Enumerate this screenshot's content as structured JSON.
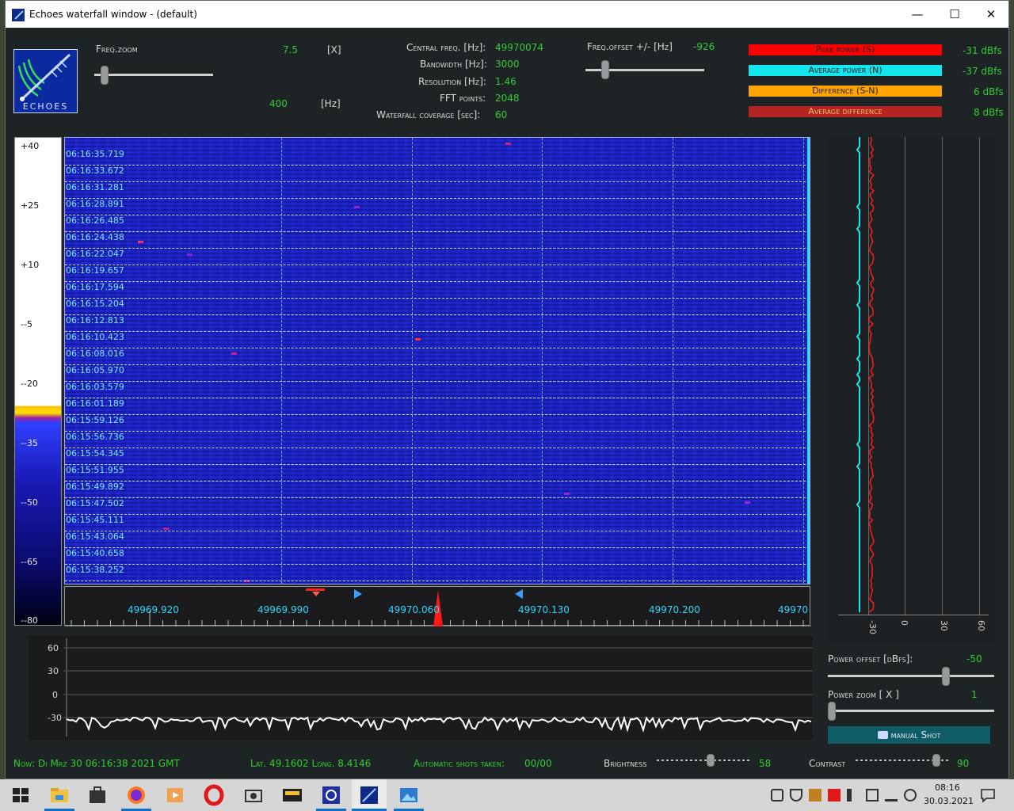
{
  "window": {
    "title": "Echoes waterfall window - (default)",
    "minimize": "—",
    "maximize": "☐",
    "close": "✕"
  },
  "logo": {
    "text": "ECHOES"
  },
  "header": {
    "freq_zoom_label": "Freq.zoom",
    "freq_zoom_value": "7.5",
    "freq_zoom_unit": "[X]",
    "freq_zoom_value2": "400",
    "freq_zoom_unit2": "[Hz]",
    "central_freq_label": "Central freq. [Hz]:",
    "central_freq_value": "49970074",
    "bandwidth_label": "Bandwidth [Hz]:",
    "bandwidth_value": "3000",
    "resolution_label": "Resolution [Hz]:",
    "resolution_value": "1.46",
    "fft_label": "FFT points:",
    "fft_value": "2048",
    "coverage_label": "Waterfall coverage [sec]:",
    "coverage_value": "60",
    "offset_label": "Freq.offset +/- [Hz]",
    "offset_value": "-926"
  },
  "meters": [
    {
      "label": "Peak power (S)",
      "value": "-31 dBfs",
      "color": "#ff0000"
    },
    {
      "label": "Average power (N)",
      "value": "-37 dBfs",
      "color": "#14e6ef"
    },
    {
      "label": "Difference (S-N)",
      "value": "6 dBfs",
      "color": "#ffa400"
    },
    {
      "label": "Average difference",
      "value": "8 dBfs",
      "color": "#b52222"
    }
  ],
  "color_scale": [
    "+40",
    "+25",
    "+10",
    "--5",
    "--20",
    "--35",
    "--50",
    "--65",
    "--80"
  ],
  "timestamps": [
    "06:16:35.719",
    "06:16:33.672",
    "06:16:31.281",
    "06:16:28.891",
    "06:16:26.485",
    "06:16:24.438",
    "06:16:22.047",
    "06:16:19.657",
    "06:16:17.594",
    "06:16:15.204",
    "06:16:12.813",
    "06:16:10.423",
    "06:16:08.016",
    "06:16:05.970",
    "06:16:03.579",
    "06:16:01.189",
    "06:15:59.126",
    "06:15:56.736",
    "06:15:54.345",
    "06:15:51.955",
    "06:15:49.892",
    "06:15:47.502",
    "06:15:45.111",
    "06:15:43.064",
    "06:15:40.658",
    "06:15:38.252"
  ],
  "freq_labels": [
    "49969.920",
    "49969.990",
    "49970.060",
    "49970.130",
    "49970.200",
    "49970"
  ],
  "power_labels": [
    "-30",
    "0",
    "30",
    "60"
  ],
  "bottom_plot_labels": [
    "60",
    "30",
    "0",
    "-30"
  ],
  "controls": {
    "power_offset_label": "Power offset [dBfs]:",
    "power_offset_value": "-50",
    "power_zoom_label": "Power zoom  [ X ]",
    "power_zoom_value": "1",
    "manual_shot_label": "manual Shot"
  },
  "status": {
    "now": "Now: Di Mrz 30 06:16:38 2021 GMT",
    "coords": "Lat. 49.1602 Long. 8.4146",
    "shots_label": "Automatic shots taken:",
    "shots_value": "00/00",
    "brightness_label": "Brightness",
    "brightness_value": "58",
    "contrast_label": "Contrast",
    "contrast_value": "90"
  },
  "taskbar": {
    "time": "08:16",
    "date": "30.03.2021"
  }
}
